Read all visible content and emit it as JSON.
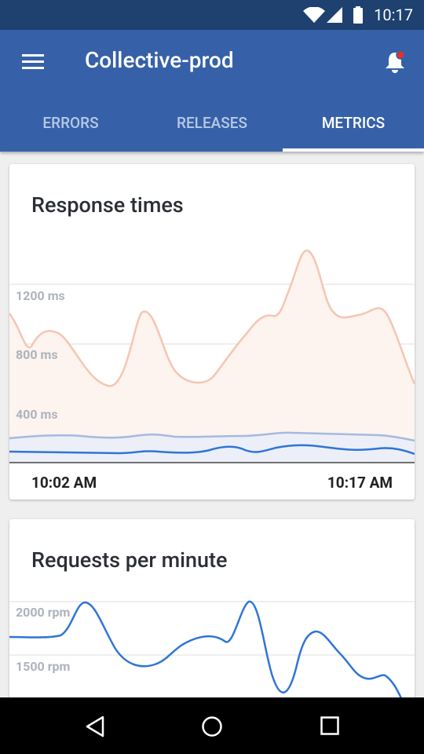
{
  "status_bar": {
    "time": "10:17"
  },
  "app_bar": {
    "title": "Collective-prod"
  },
  "tabs": [
    {
      "label": "ERRORS",
      "active": false
    },
    {
      "label": "RELEASES",
      "active": false
    },
    {
      "label": "METRICS",
      "active": true
    }
  ],
  "response_card": {
    "title": "Response times",
    "y_labels": [
      "1200 ms",
      "800 ms",
      "400 ms"
    ],
    "x_start": "10:02 AM",
    "x_end": "10:17 AM"
  },
  "requests_card": {
    "title": "Requests per minute",
    "y_labels": [
      "2000 rpm",
      "1500 rpm"
    ]
  },
  "colors": {
    "primary": "#3661a8",
    "status_bar": "#1e416f",
    "notification_dot": "#e0322a",
    "response_p95_line": "#f4c6b2",
    "response_p50_line": "#a6b9df",
    "response_p10_line": "#2f75d6",
    "requests_line": "#2f75d6"
  }
}
